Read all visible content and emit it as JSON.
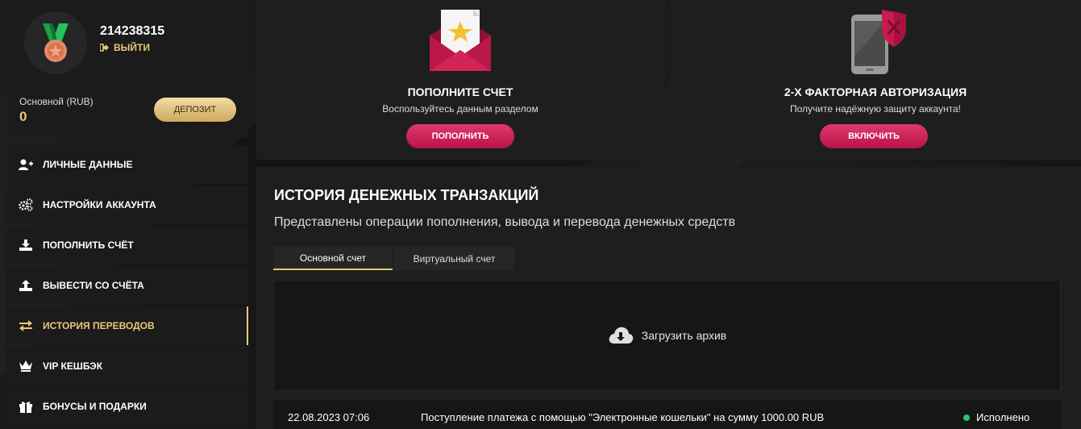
{
  "user": {
    "id": "214238315",
    "logout_label": "ВЫЙТИ",
    "account_label": "Основной (RUB)",
    "balance": "0",
    "deposit_label": "ДЕПОЗИТ"
  },
  "menu": [
    {
      "label": "ЛИЧНЫЕ ДАННЫЕ",
      "icon": "user-plus-icon"
    },
    {
      "label": "НАСТРОЙКИ АККАУНТА",
      "icon": "gears-icon"
    },
    {
      "label": "ПОПОЛНИТЬ СЧЁТ",
      "icon": "download-icon"
    },
    {
      "label": "ВЫВЕСТИ СО СЧЁТА",
      "icon": "upload-icon"
    },
    {
      "label": "ИСТОРИЯ ПЕРЕВОДОВ",
      "icon": "transfer-arrows-icon",
      "active": true
    },
    {
      "label": "VIP КЕШБЭК",
      "icon": "crown-icon"
    },
    {
      "label": "БОНУСЫ И ПОДАРКИ",
      "icon": "gift-icon"
    }
  ],
  "cards": {
    "deposit": {
      "title": "ПОПОЛНИТЕ СЧЕТ",
      "subtitle": "Воспользуйтесь данным разделом",
      "button": "ПОПОЛНИТЬ",
      "icon": "envelope-star-icon"
    },
    "twofa": {
      "title": "2-Х ФАКТОРНАЯ АВТОРИЗАЦИЯ",
      "subtitle": "Получите надёжную защиту аккаунта!",
      "button": "ВКЛЮЧИТЬ",
      "icon": "phone-shield-icon"
    }
  },
  "history": {
    "title": "ИСТОРИЯ ДЕНЕЖНЫХ ТРАНЗАКЦИЙ",
    "subtitle": "Представлены операции пополнения, вывода и перевода денежных средств",
    "tabs": [
      "Основной счет",
      "Виртуальный счет"
    ],
    "archive_label": "Загрузить архив",
    "transactions": [
      {
        "date": "22.08.2023 07:06",
        "description": "Поступление платежа с помощью \"Электронные кошельки\" на сумму 1000.00 RUB",
        "status": "Исполнено"
      }
    ]
  },
  "colors": {
    "gold": "#e8c97a",
    "pink": "#d1245c",
    "success": "#2fbf71"
  }
}
